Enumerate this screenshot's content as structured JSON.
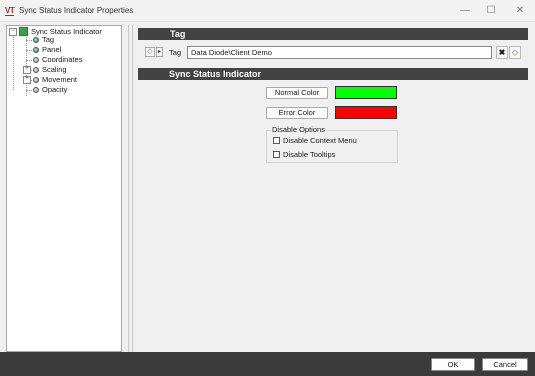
{
  "window": {
    "logo": "VT",
    "title": "Sync Status Indicator Properties",
    "min_glyph": "—",
    "max_glyph": "☐",
    "close_glyph": "✕"
  },
  "tree": {
    "root": {
      "label": "Sync Status Indicator",
      "expander": "−"
    },
    "items": [
      {
        "label": "Tag",
        "status": "green",
        "expander": ""
      },
      {
        "label": "Panel",
        "status": "green",
        "expander": ""
      },
      {
        "label": "Coordinates",
        "status": "gray",
        "expander": ""
      },
      {
        "label": "Scaling",
        "status": "gray",
        "expander": "+"
      },
      {
        "label": "Movement",
        "status": "gray",
        "expander": "+"
      },
      {
        "label": "Opacity",
        "status": "gray",
        "expander": ""
      }
    ]
  },
  "tag_section": {
    "header": "Tag",
    "tag_label": "Tag",
    "tag_value": "Data Diode\\Client Demo",
    "tag_button_icon": "tag-icon",
    "expand_arrow_icon": "arrow-right-icon",
    "clear_icon": "clear-x-icon",
    "browse_icon": "tag-browse-icon"
  },
  "indicator_section": {
    "header": "Sync Status Indicator",
    "normal_color_label": "Normal Color",
    "normal_color": "#00ff00",
    "error_color_label": "Error Color",
    "error_color": "#ff0000",
    "disable_options": {
      "legend": "Disable Options",
      "context_menu": {
        "label": "Disable Context Menu",
        "checked": false
      },
      "tooltips": {
        "label": "Disable Tooltips",
        "checked": false
      }
    }
  },
  "footer": {
    "ok_label": "OK",
    "cancel_label": "Cancel"
  }
}
